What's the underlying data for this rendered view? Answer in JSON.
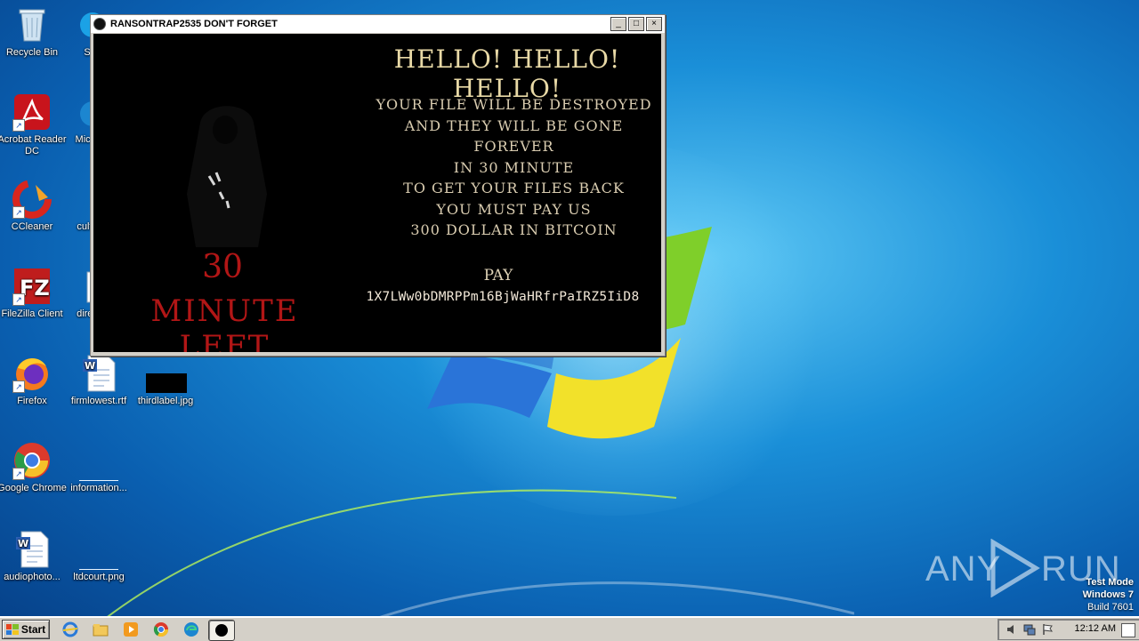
{
  "window": {
    "title": "RANSONTRAP2535 DON'T FORGET",
    "minimize_glyph": "_",
    "maximize_glyph": "□",
    "close_glyph": "×",
    "hello": "HELLO! HELLO! HELLO!",
    "message_lines": [
      "YOUR FILE WILL BE DESTROYED",
      "AND THEY WILL BE GONE FOREVER",
      "IN 30 MINUTE",
      "TO GET YOUR FILES BACK",
      "YOU MUST PAY US",
      "300 DOLLAR IN BITCOIN"
    ],
    "countdown_number": "30",
    "countdown_label": "MINUTE LEFT",
    "pay_label": "PAY",
    "bitcoin_address": "1X7LWw0bDMRPPm16BjWaHRfrPaIRZ5IiD8"
  },
  "desktop_icons": [
    {
      "label": "Recycle Bin",
      "icon": "recycle-bin-icon"
    },
    {
      "label": "Acrobat Reader DC",
      "icon": "acrobat-icon"
    },
    {
      "label": "CCleaner",
      "icon": "ccleaner-icon"
    },
    {
      "label": "FileZilla Client",
      "icon": "filezilla-icon"
    },
    {
      "label": "Firefox",
      "icon": "firefox-icon"
    },
    {
      "label": "Google Chrome",
      "icon": "chrome-icon"
    },
    {
      "label": "audiophoto...",
      "icon": "word-doc-icon"
    },
    {
      "label": "S",
      "icon": "skype-icon"
    },
    {
      "label": "Micro",
      "icon": "edge-icon"
    },
    {
      "label": "cultu",
      "icon": "file-icon"
    },
    {
      "label": "direc",
      "icon": "word-doc-icon"
    },
    {
      "label": "firmlowest.rtf",
      "icon": "word-doc-icon"
    },
    {
      "label": "thirdlabel.jpg",
      "icon": "image-icon"
    },
    {
      "label": "information...",
      "icon": "file-icon"
    },
    {
      "label": "ltdcourt.png",
      "icon": "image-icon"
    }
  ],
  "watermark": {
    "left": "ANY",
    "right": "RUN"
  },
  "sysinfo": {
    "mode": "Test Mode",
    "os": "Windows 7",
    "build": "Build 7601"
  },
  "taskbar": {
    "start_label": "Start",
    "clock": "12:12 AM",
    "icons": [
      "ie-icon",
      "explorer-icon",
      "media-player-icon",
      "chrome-icon",
      "edge-icon",
      "ransom-app-icon"
    ]
  }
}
